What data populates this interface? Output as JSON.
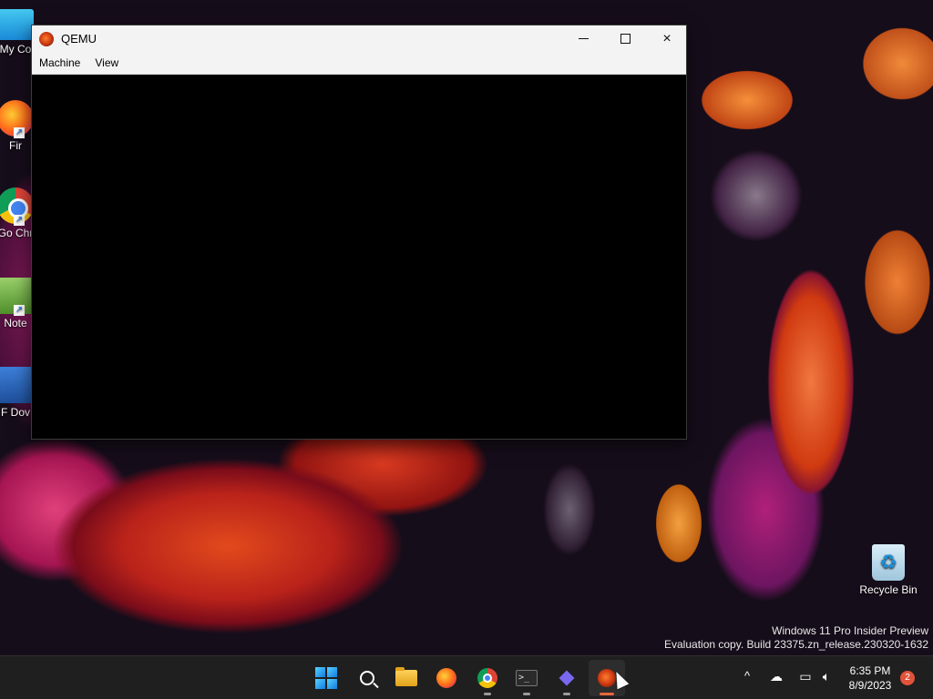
{
  "desktop": {
    "icons": [
      {
        "label": "My Co"
      },
      {
        "label": "Fir"
      },
      {
        "label": "Go Chr"
      },
      {
        "label": "Note"
      },
      {
        "label": "F Dov"
      },
      {
        "label": "Recycle Bin"
      }
    ],
    "watermark": {
      "line1": "Windows 11 Pro Insider Preview",
      "line2": "Evaluation copy. Build 23375.zn_release.230320-1632"
    }
  },
  "window": {
    "title": "QEMU",
    "menu": [
      "Machine",
      "View"
    ],
    "controls": {
      "minimize": "minimize-icon",
      "maximize": "maximize-icon",
      "close": "×"
    }
  },
  "taskbar": {
    "apps": [
      "start",
      "search",
      "file-explorer",
      "firefox",
      "chrome",
      "terminal",
      "visual-studio",
      "qemu"
    ],
    "active_app": "qemu",
    "terminal_glyph": ">_",
    "tray": {
      "chevron": "^",
      "time": "6:35 PM",
      "date": "8/9/2023",
      "notification_count": "2"
    }
  },
  "colors": {
    "accent_indicator": "#e8653a",
    "taskbar_bg": "#1f1f1f",
    "titlebar_bg": "#f3f3f3"
  }
}
